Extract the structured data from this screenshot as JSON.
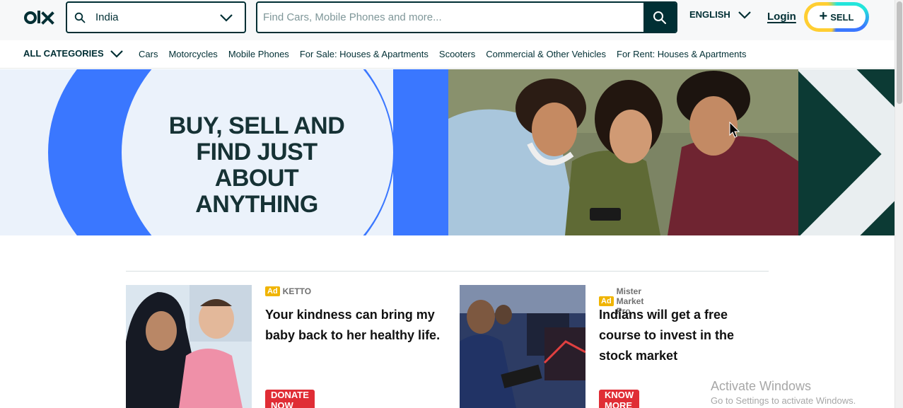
{
  "header": {
    "location": {
      "value": "India"
    },
    "search": {
      "placeholder": "Find Cars, Mobile Phones and more..."
    },
    "language": "ENGLISH",
    "login": "Login",
    "sell": "SELL"
  },
  "categories": {
    "all_label": "ALL CATEGORIES",
    "items": [
      "Cars",
      "Motorcycles",
      "Mobile Phones",
      "For Sale: Houses & Apartments",
      "Scooters",
      "Commercial & Other Vehicles",
      "For Rent: Houses & Apartments"
    ]
  },
  "banner": {
    "line1": "BUY, SELL AND",
    "line2": "FIND JUST ABOUT",
    "line3": "ANYTHING"
  },
  "ads": [
    {
      "badge": "Ad",
      "advertiser": "KETTO",
      "title": "Your kindness can bring my baby back to her healthy life.",
      "button": "DONATE NOW"
    },
    {
      "badge": "Ad",
      "advertiser": "Mister Market Pro",
      "title": "Indians will get a free course to invest in the stock market",
      "button": "KNOW MORE"
    }
  ],
  "watermark": {
    "title": "Activate Windows",
    "subtitle": "Go to Settings to activate Windows."
  },
  "colors": {
    "brand_dark": "#002f34",
    "accent_blue": "#3a77ff",
    "ad_button": "#e02d35",
    "ad_badge": "#f0b400"
  }
}
